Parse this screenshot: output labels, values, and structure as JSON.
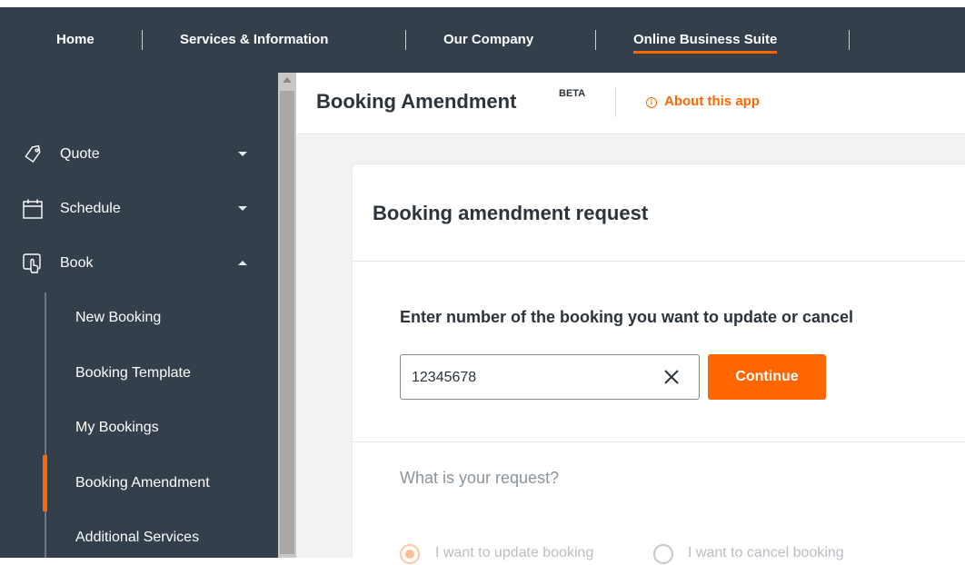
{
  "topnav": {
    "items": [
      {
        "label": "Home"
      },
      {
        "label": "Services & Information"
      },
      {
        "label": "Our Company"
      },
      {
        "label": "Online Business Suite"
      }
    ]
  },
  "sidebar": {
    "items": [
      {
        "label": "Quote",
        "icon": "tag-icon"
      },
      {
        "label": "Schedule",
        "icon": "calendar-icon"
      },
      {
        "label": "Book",
        "icon": "hand-pointer-icon"
      }
    ],
    "book_subitems": [
      {
        "label": "New Booking"
      },
      {
        "label": "Booking Template"
      },
      {
        "label": "My Bookings"
      },
      {
        "label": "Booking Amendment"
      },
      {
        "label": "Additional Services"
      }
    ]
  },
  "header": {
    "title": "Booking Amendment",
    "badge": "BETA",
    "about": "About this app",
    "about_icon": "i"
  },
  "card": {
    "title": "Booking amendment request",
    "prompt": "Enter number of the booking you want to update or cancel",
    "booking_number": "12345678",
    "continue_label": "Continue",
    "request_question": "What is your request?",
    "options": [
      {
        "label": "I want to update booking",
        "selected": true
      },
      {
        "label": "I want to cancel booking",
        "selected": false
      }
    ]
  },
  "colors": {
    "nav_bg": "#333f4b",
    "accent": "#ff6600"
  }
}
